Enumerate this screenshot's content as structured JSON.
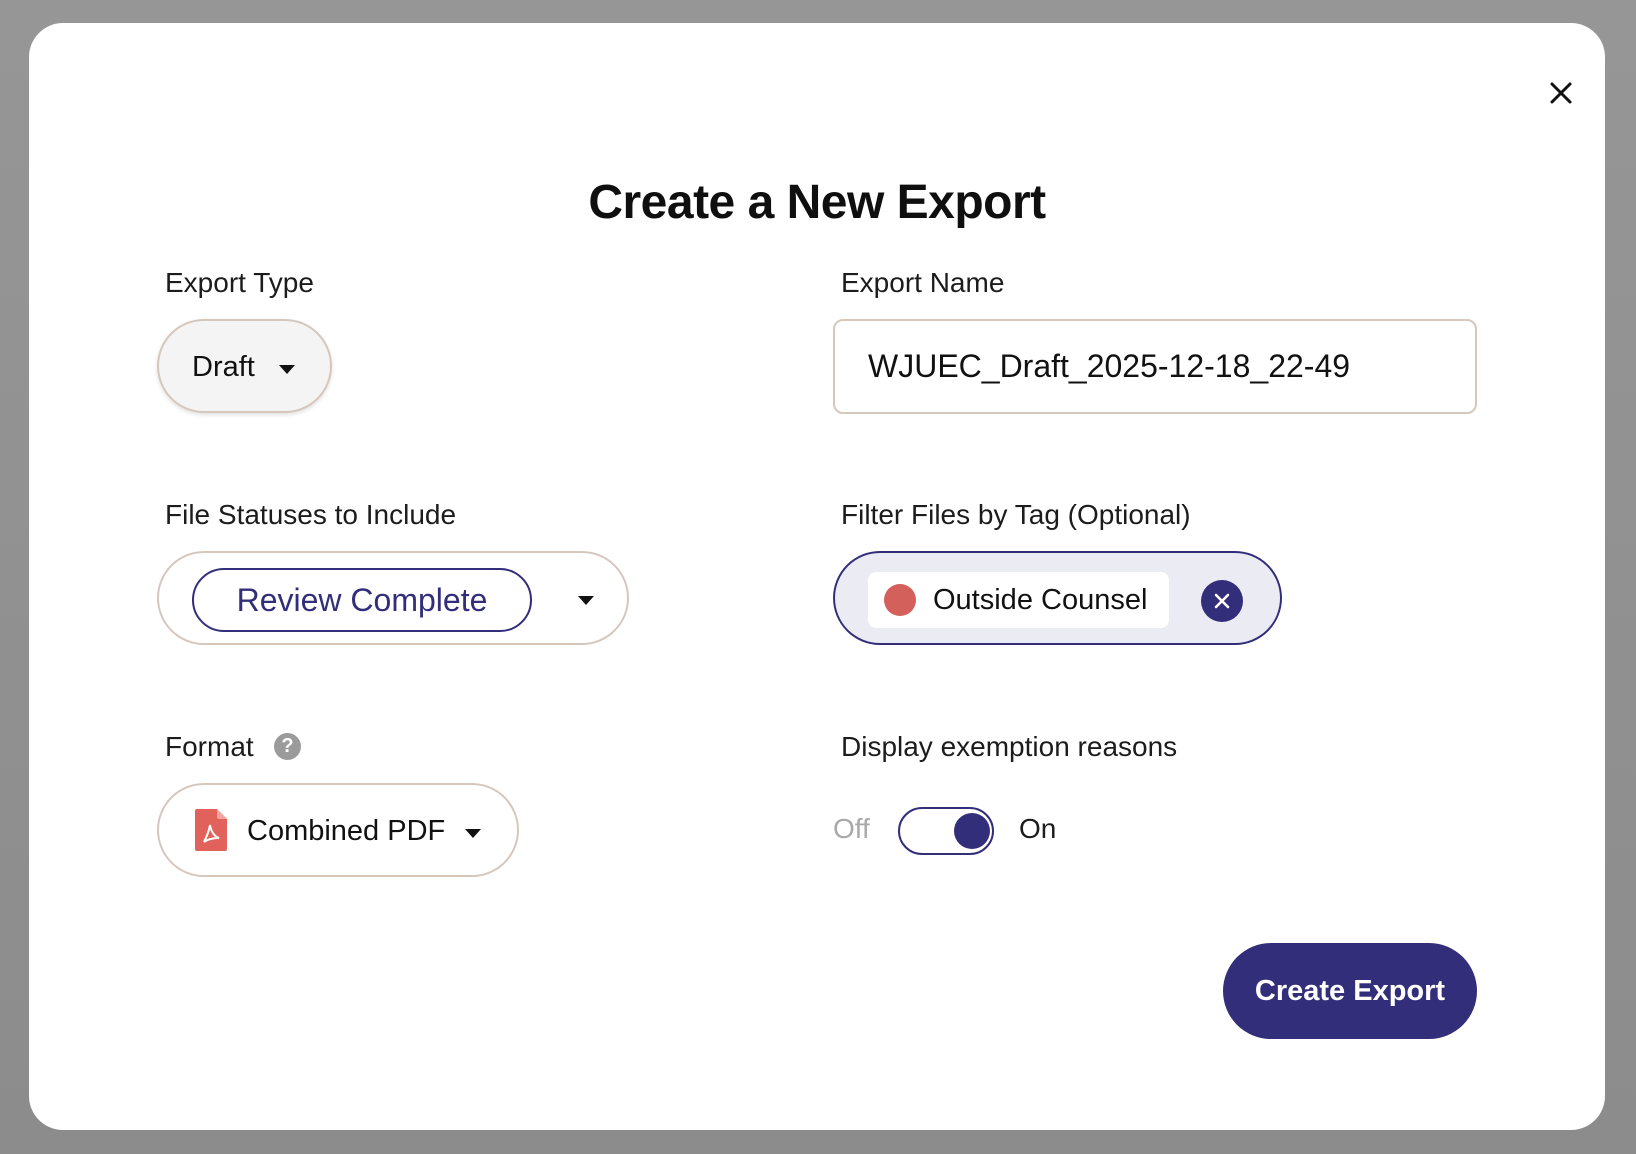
{
  "modal": {
    "title": "Create a New Export",
    "close_icon": "close-icon"
  },
  "export_type": {
    "label": "Export Type",
    "value": "Draft"
  },
  "export_name": {
    "label": "Export Name",
    "value": "WJUEC_Draft_2025-12-18_22-49"
  },
  "file_statuses": {
    "label": "File Statuses to Include",
    "selected": [
      "Review Complete"
    ]
  },
  "tag_filter": {
    "label": "Filter Files by Tag (Optional)",
    "tags": [
      {
        "name": "Outside Counsel",
        "color": "#d3605a"
      }
    ]
  },
  "format": {
    "label": "Format",
    "help_icon": "question-mark-icon",
    "help_glyph": "?",
    "value": "Combined PDF",
    "icon": "pdf-file-icon"
  },
  "exemption_reasons": {
    "label": "Display exemption reasons",
    "off_label": "Off",
    "on_label": "On",
    "enabled": true
  },
  "actions": {
    "create_label": "Create Export"
  },
  "colors": {
    "accent": "#332e7a",
    "tag_red": "#d3605a",
    "pdf_red": "#e0625a",
    "border": "#d6c7bd"
  }
}
